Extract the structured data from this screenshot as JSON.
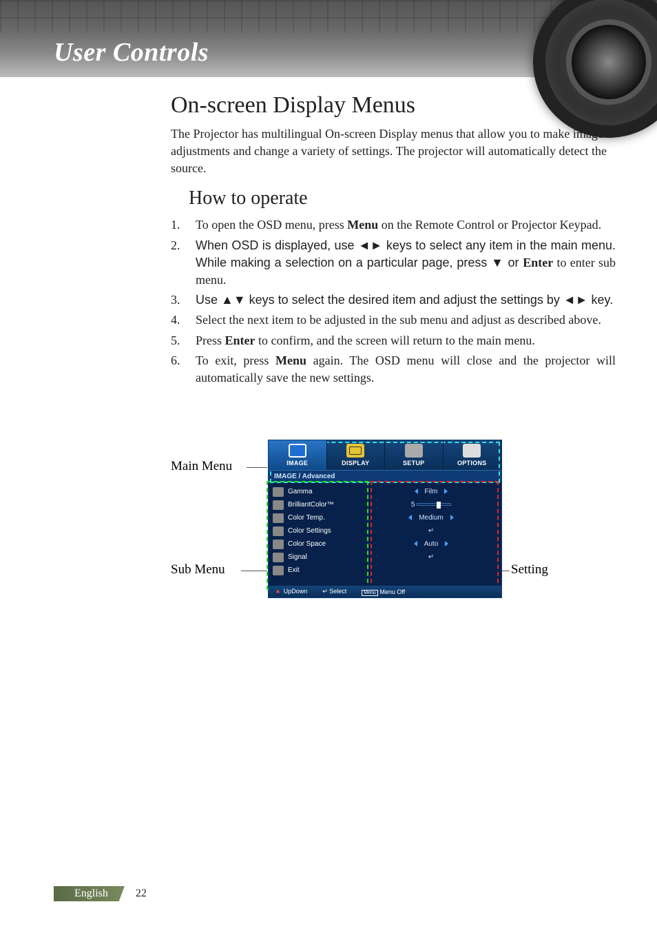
{
  "header": {
    "section_title": "User Controls"
  },
  "headings": {
    "h1": "On-screen Display Menus",
    "h2": "How to operate"
  },
  "intro": "The Projector has multilingual On-screen Display menus that allow you to make image adjustments and change a variety of settings. The projector will automatically detect the source.",
  "steps": [
    {
      "pre": "To open the OSD menu, press ",
      "bold": "Menu",
      "post": " on the Remote Control or Projector Keypad."
    },
    {
      "pre": "When OSD is displayed, use ◄► keys to select any item in the main menu. While making a selection on a particular page, press ▼ or ",
      "bold": "Enter",
      "post": " to enter sub menu."
    },
    {
      "pre": "Use ▲▼ keys to select the desired item and adjust the settings by ◄► key.",
      "bold": "",
      "post": ""
    },
    {
      "pre": "Select the next item to be adjusted in the sub menu and adjust as described above.",
      "bold": "",
      "post": ""
    },
    {
      "pre": "Press ",
      "bold": "Enter",
      "post": " to confirm, and the screen will return to the main menu."
    },
    {
      "pre": "To exit, press ",
      "bold": "Menu",
      "post": " again. The OSD menu will close and the projector will automatically save the new settings."
    }
  ],
  "diagram_labels": {
    "main_menu": "Main Menu",
    "sub_menu": "Sub Menu",
    "setting": "Setting"
  },
  "osd": {
    "tabs": [
      {
        "label": "IMAGE",
        "active": true
      },
      {
        "label": "DISPLAY",
        "active": false
      },
      {
        "label": "SETUP",
        "active": false
      },
      {
        "label": "OPTIONS",
        "active": false
      }
    ],
    "breadcrumb": "IMAGE / Advanced",
    "rows": [
      {
        "icon": "ri-gamma",
        "label": "Gamma",
        "type": "arrows",
        "value": "Film"
      },
      {
        "icon": "ri-bc",
        "label": "BrilliantColor™",
        "type": "slider",
        "value": "5"
      },
      {
        "icon": "ri-ct",
        "label": "Color Temp.",
        "type": "arrows",
        "value": "Medium"
      },
      {
        "icon": "ri-cs",
        "label": "Color Settings",
        "type": "enter",
        "value": "↵"
      },
      {
        "icon": "ri-csp",
        "label": "Color Space",
        "type": "arrows",
        "value": "Auto"
      },
      {
        "icon": "ri-sig",
        "label": "Signal",
        "type": "enter",
        "value": "↵"
      },
      {
        "icon": "ri-exit",
        "label": "Exit",
        "type": "none",
        "value": ""
      }
    ],
    "footer": {
      "updown": "UpDown",
      "select": "Select",
      "menu_off_key": "Menu",
      "menu_off": "Menu Off"
    }
  },
  "footer": {
    "language": "English",
    "page_number": "22"
  }
}
